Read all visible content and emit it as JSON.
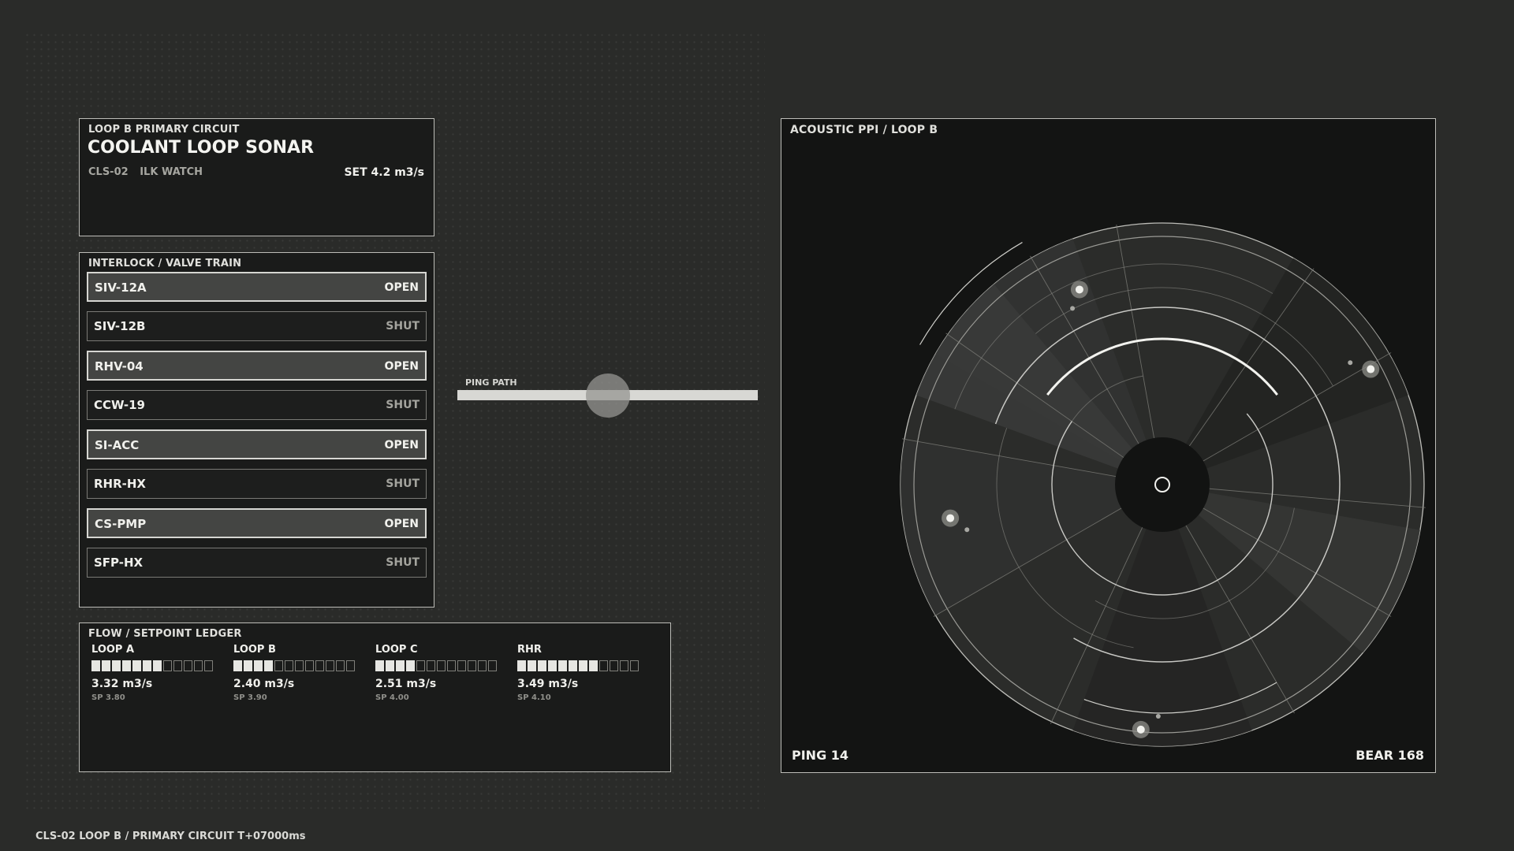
{
  "header": {
    "kicker": "LOOP B  PRIMARY CIRCUIT",
    "title": "COOLANT LOOP SONAR",
    "id": "CLS-02",
    "mode": "ILK WATCH",
    "setpoint": "SET  4.2 m3/s"
  },
  "interlock": {
    "title": "INTERLOCK / VALVE TRAIN",
    "valves": [
      {
        "name": "SIV-12A",
        "state": "OPEN"
      },
      {
        "name": "SIV-12B",
        "state": "SHUT"
      },
      {
        "name": "RHV-04",
        "state": "OPEN"
      },
      {
        "name": "CCW-19",
        "state": "SHUT"
      },
      {
        "name": "SI-ACC",
        "state": "OPEN"
      },
      {
        "name": "RHR-HX",
        "state": "SHUT"
      },
      {
        "name": "CS-PMP",
        "state": "OPEN"
      },
      {
        "name": "SFP-HX",
        "state": "SHUT"
      }
    ]
  },
  "ping_path": {
    "label": "PING PATH",
    "position": 0.5
  },
  "flow": {
    "title": "FLOW / SETPOINT LEDGER",
    "loops": [
      {
        "name": "LOOP A",
        "segments_on": 7,
        "segments_total": 12,
        "value": "3.32 m3/s",
        "setpoint": "SP 3.80"
      },
      {
        "name": "LOOP B",
        "segments_on": 4,
        "segments_total": 12,
        "value": "2.40 m3/s",
        "setpoint": "SP 3.90"
      },
      {
        "name": "LOOP C",
        "segments_on": 4,
        "segments_total": 12,
        "value": "2.51 m3/s",
        "setpoint": "SP 4.00"
      },
      {
        "name": "RHR",
        "segments_on": 8,
        "segments_total": 12,
        "value": "3.49 m3/s",
        "setpoint": "SP 4.10"
      }
    ]
  },
  "ppi": {
    "title": "ACOUSTIC PPI  /  LOOP B",
    "ping": "PING 14",
    "bearing": "BEAR 168",
    "contacts": [
      {
        "angle_deg": -29,
        "range": 0.91
      },
      {
        "angle_deg": 95,
        "range": 0.94
      },
      {
        "angle_deg": 171,
        "range": 0.82
      },
      {
        "angle_deg": 247,
        "range": 0.81
      }
    ]
  },
  "footer": {
    "status": "CLS-02  LOOP B / PRIMARY CIRCUIT  T+07000ms"
  }
}
